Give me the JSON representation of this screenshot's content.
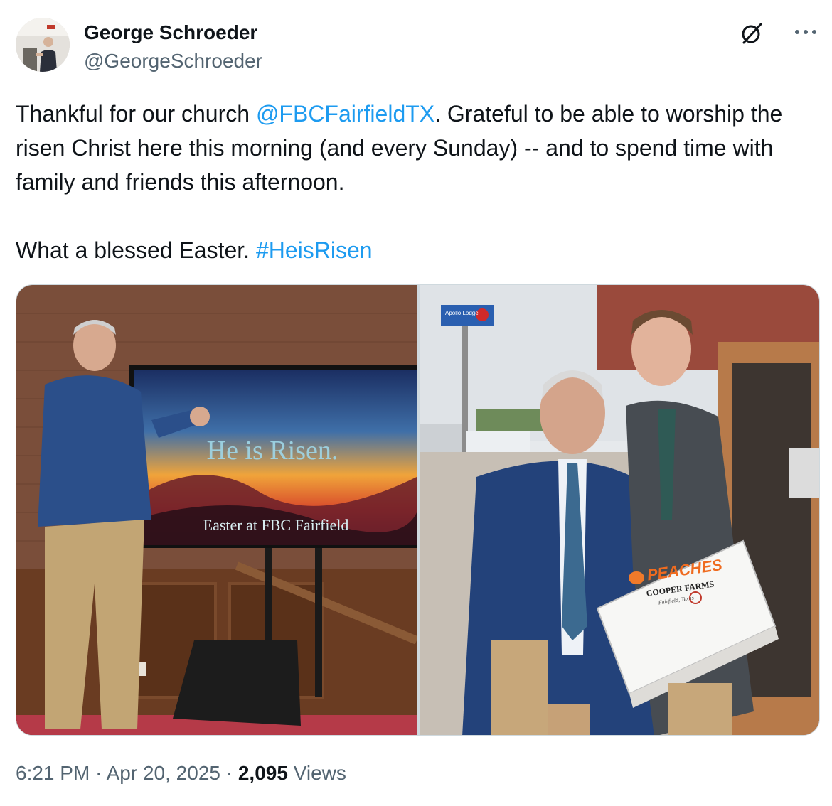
{
  "author": {
    "name": "George Schroeder",
    "handle": "@GeorgeSchroeder"
  },
  "icons": {
    "grok": "grok-icon",
    "more": "more-icon"
  },
  "tweet": {
    "line1_pre": "Thankful for our church ",
    "mention": "@FBCFairfieldTX",
    "line1_post": ". Grateful to be able to worship the risen Christ here this morning (and every Sunday) -- and to spend time with family and friends this afternoon.",
    "line2_pre": "What a blessed Easter. ",
    "hashtag": "#HeisRisen"
  },
  "media": {
    "left_photo": {
      "screen_title": "He is Risen.",
      "screen_subtitle": "Easter at FBC Fairfield"
    },
    "right_photo": {
      "sign_text": "Apollo Lodge",
      "box_brand": "PEACHES",
      "box_farm": "COOPER FARMS",
      "box_location": "Fairfield, Texas"
    }
  },
  "footer": {
    "time": "6:21 PM",
    "separator": " · ",
    "date": "Apr 20, 2025",
    "views_count": "2,095",
    "views_label": " Views"
  },
  "colors": {
    "link": "#1d9bf0",
    "secondary_text": "#536471",
    "primary_text": "#0f1419",
    "border": "#cfd9de"
  }
}
